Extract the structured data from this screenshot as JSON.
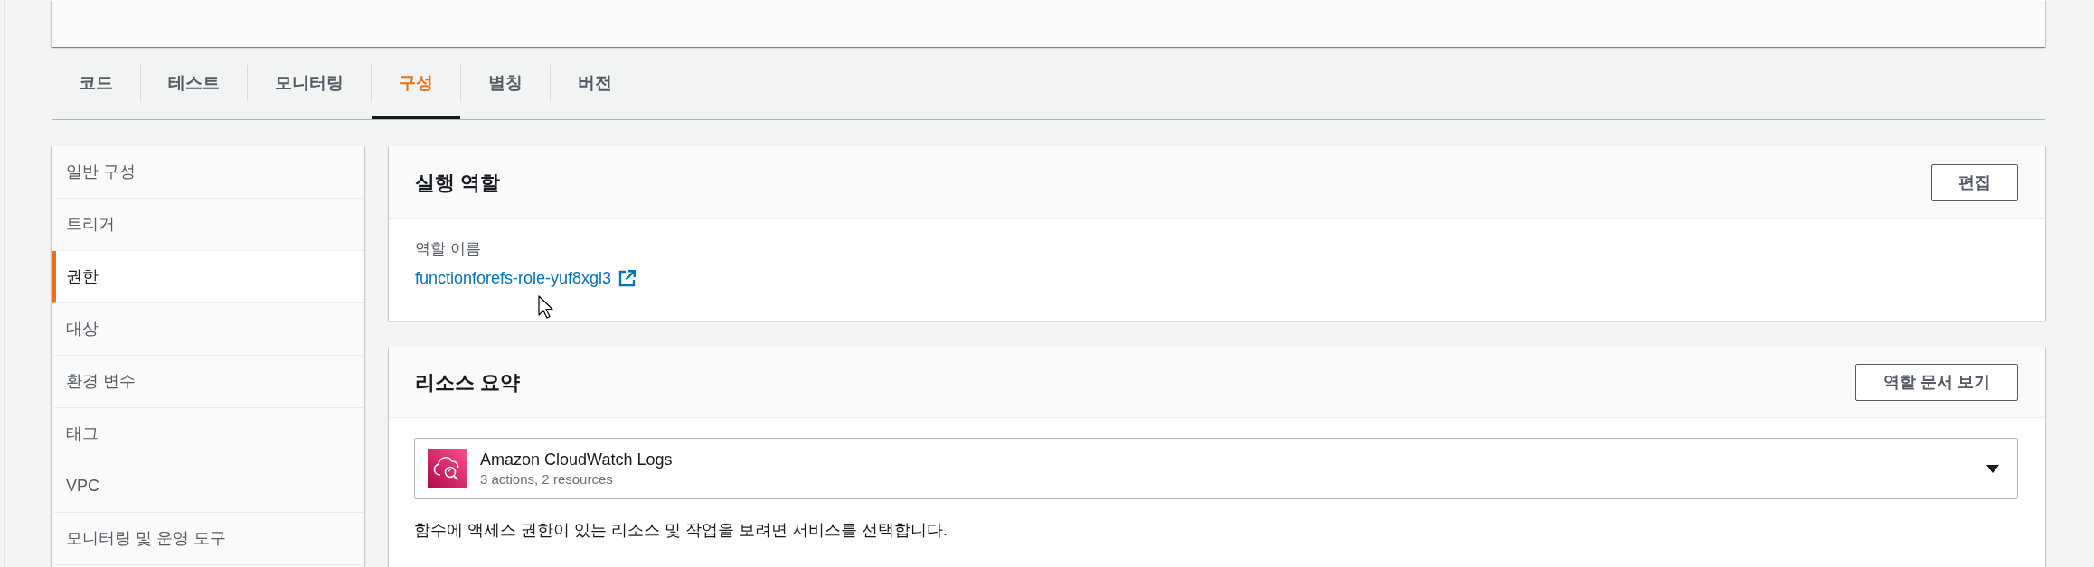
{
  "tabs": [
    {
      "label": "코드",
      "selected": false
    },
    {
      "label": "테스트",
      "selected": false
    },
    {
      "label": "모니터링",
      "selected": false
    },
    {
      "label": "구성",
      "selected": true
    },
    {
      "label": "별칭",
      "selected": false
    },
    {
      "label": "버전",
      "selected": false
    }
  ],
  "sidebar": {
    "items": [
      {
        "label": "일반 구성",
        "selected": false
      },
      {
        "label": "트리거",
        "selected": false
      },
      {
        "label": "권한",
        "selected": true
      },
      {
        "label": "대상",
        "selected": false
      },
      {
        "label": "환경 변수",
        "selected": false
      },
      {
        "label": "태그",
        "selected": false
      },
      {
        "label": "VPC",
        "selected": false
      },
      {
        "label": "모니터링 및 운영 도구",
        "selected": false
      }
    ]
  },
  "execution_role": {
    "title": "실행 역할",
    "edit_button": "편집",
    "role_name_label": "역할 이름",
    "role_name_link": "functionforefs-role-yuf8xgl3"
  },
  "resource_summary": {
    "title": "리소스 요약",
    "view_document_button": "역할 문서 보기",
    "service_select": {
      "value": "Amazon CloudWatch Logs",
      "summary": "3 actions, 2 resources"
    },
    "description": "함수에 액세스 권한이 있는 리소스 및 작업을 보려면 서비스를 선택합니다."
  }
}
